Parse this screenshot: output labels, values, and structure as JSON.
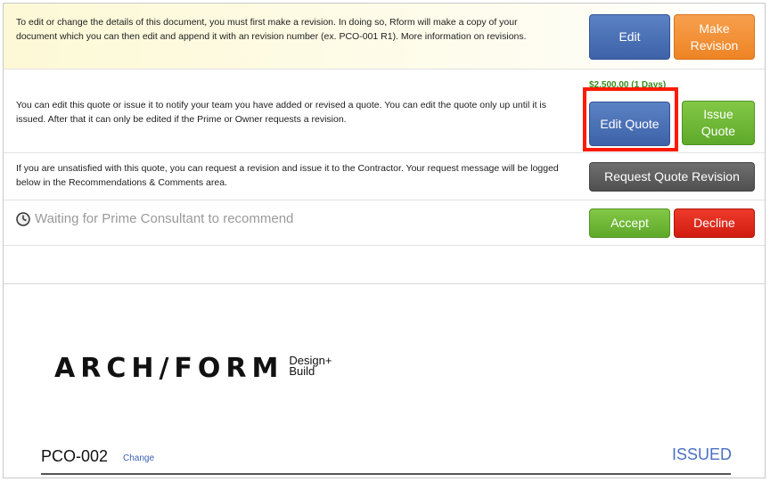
{
  "revision_row": {
    "text": "To edit or change the details of this document, you must first make a revision. In doing so, Rform will make a copy of your document which you can then edit and append it with an revision number (ex. PCO-001 R1). More information on revisions.",
    "edit_label": "Edit",
    "make_revision_label": "Make Revision"
  },
  "quote_row": {
    "text": "You can edit this quote or issue it to notify your team you have added or revised a quote. You can edit the quote only up until it is issued. After that it can only be edited if the Prime or Owner requests a revision.",
    "price": "$2,500.00 (1 Days)",
    "edit_quote_label": "Edit Quote",
    "issue_quote_label": "Issue Quote"
  },
  "request_row": {
    "text": "If you are unsatisfied with this quote, you can request a revision and issue it to the Contractor. Your request message will be logged below in the Recommendations & Comments area.",
    "request_label": "Request Quote Revision"
  },
  "status_row": {
    "icon": "clock-icon",
    "text": "Waiting for Prime Consultant to recommend",
    "accept_label": "Accept",
    "decline_label": "Decline"
  },
  "document": {
    "logo_main": "ARCH/FORM",
    "logo_sub_line1": "Design+",
    "logo_sub_line2": "Build",
    "pco_id": "PCO-002",
    "change_link": "Change",
    "status": "ISSUED"
  },
  "colors": {
    "highlight": "#ff1a00",
    "yellow_row": "#fefbe0",
    "status_blue": "#4a6fc4"
  }
}
